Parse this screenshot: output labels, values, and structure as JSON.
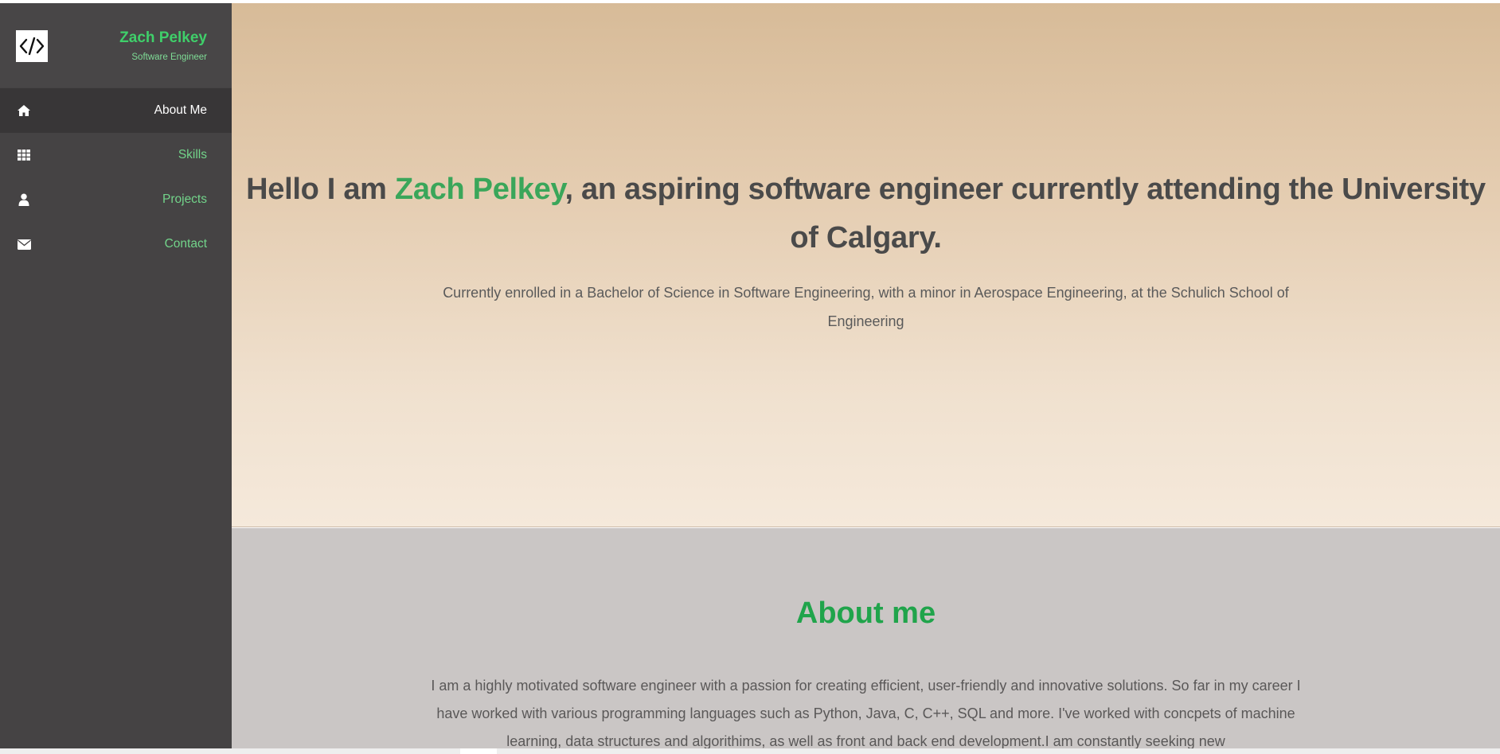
{
  "sidebar": {
    "logo_icon": "code-icon",
    "name": "Zach Pelkey",
    "role": "Software Engineer",
    "items": [
      {
        "label": "About Me",
        "icon": "home-icon",
        "active": true
      },
      {
        "label": "Skills",
        "icon": "grid-icon",
        "active": false
      },
      {
        "label": "Projects",
        "icon": "user-icon",
        "active": false
      },
      {
        "label": "Contact",
        "icon": "envelope-icon",
        "active": false
      }
    ]
  },
  "hero": {
    "title_prefix": "Hello I am ",
    "title_name": "Zach Pelkey",
    "title_suffix": ", an aspiring software engineer currently attending the University of Calgary.",
    "subtitle": "Currently enrolled in a Bachelor of Science in Software Engineering, with a minor in Aerospace Engineering, at the Schulich School of Engineering"
  },
  "about": {
    "title": "About me",
    "text": "I am a highly motivated software engineer with a passion for creating efficient, user-friendly and innovative solutions. So far in my career I have worked with various programming languages such as Python, Java, C, C++, SQL and more. I've worked with concpets of machine learning, data structures and algorithims, as well as front and back end development.I am constantly seeking new"
  },
  "colors": {
    "accent": "#3fcf6a",
    "sidebar_bg": "#454344",
    "hero_top": "#d7bb98",
    "hero_bottom": "#f5e9db",
    "about_bg": "#cac6c5"
  }
}
